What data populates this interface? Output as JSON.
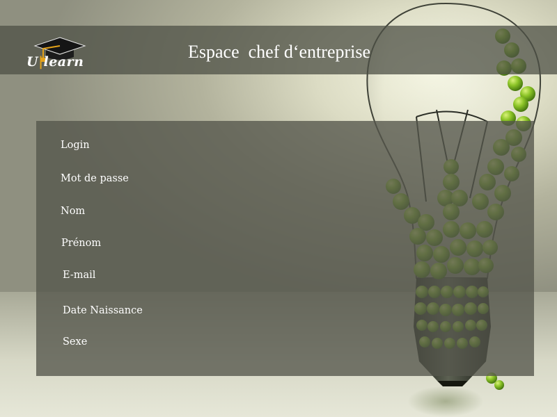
{
  "app": {
    "logo_text": "Ulearn",
    "logo_part1": "U",
    "logo_part2": "learn",
    "title": "Espace  chef d‘entreprise"
  },
  "form": {
    "labels": [
      "Login",
      "Mot de passe",
      "Nom",
      "Prénom",
      "E-mail",
      "Date Naissance",
      "Sexe"
    ]
  },
  "icons": {
    "logo": "graduation-cap-icon"
  },
  "colors": {
    "header_band": "#4e5046",
    "panel": "#55564c",
    "text": "#ffffff",
    "apple_green": "#7cb81c",
    "accent_tassel": "#e3a21a"
  }
}
